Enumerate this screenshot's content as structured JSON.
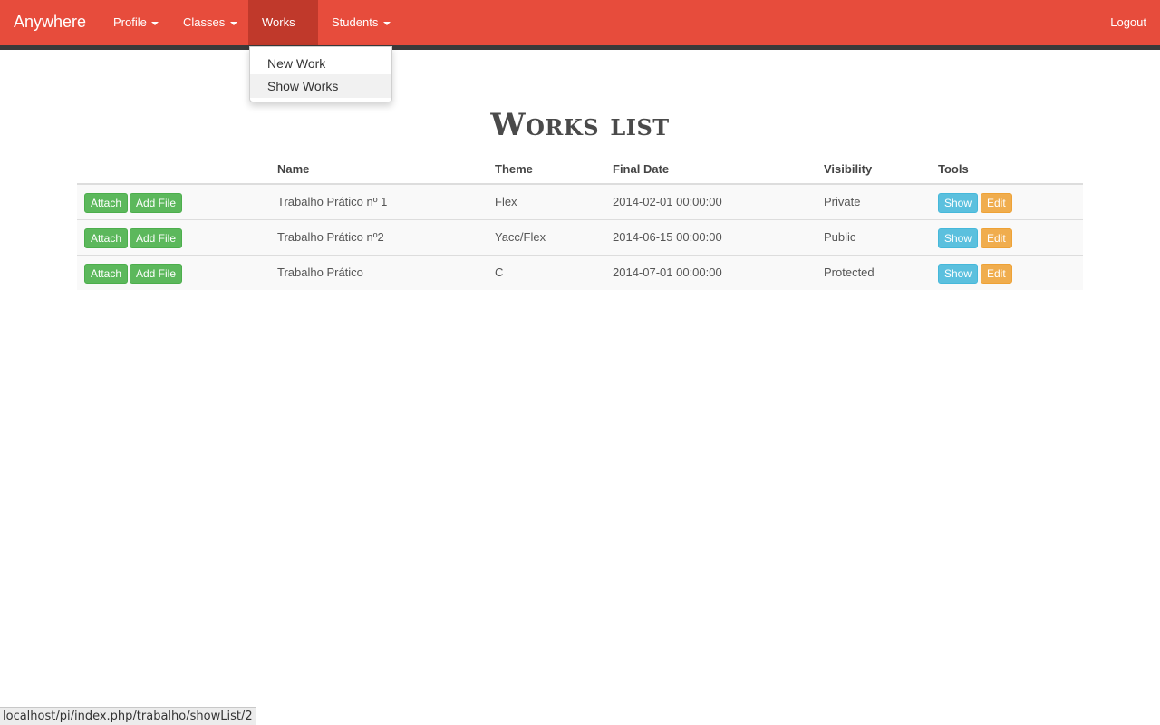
{
  "navbar": {
    "brand": "Anywhere",
    "items": [
      {
        "label": "Profile"
      },
      {
        "label": "Classes"
      },
      {
        "label": "Works"
      },
      {
        "label": "Students"
      }
    ],
    "logout": "Logout",
    "colors": {
      "bar": "#e74c3c",
      "active": "#c0392b"
    }
  },
  "dropdown": {
    "items": [
      {
        "label": "New Work"
      },
      {
        "label": "Show Works"
      }
    ]
  },
  "page": {
    "title": "Works list"
  },
  "table": {
    "columns": [
      "",
      "Name",
      "Theme",
      "Final Date",
      "Visibility",
      "Tools"
    ],
    "rows": [
      {
        "name": "Trabalho Prático nº 1",
        "theme": "Flex",
        "final_date": "2014-02-01 00:00:00",
        "visibility": "Private"
      },
      {
        "name": "Trabalho Prático nº2",
        "theme": "Yacc/Flex",
        "final_date": "2014-06-15 00:00:00",
        "visibility": "Public"
      },
      {
        "name": "Trabalho Prático",
        "theme": "C",
        "final_date": "2014-07-01 00:00:00",
        "visibility": "Protected"
      }
    ],
    "actions": {
      "attach": "Attach",
      "add_file": "Add File",
      "show": "Show",
      "edit": "Edit"
    }
  },
  "statusbar": {
    "url": "localhost/pi/index.php/trabalho/showList/2"
  }
}
